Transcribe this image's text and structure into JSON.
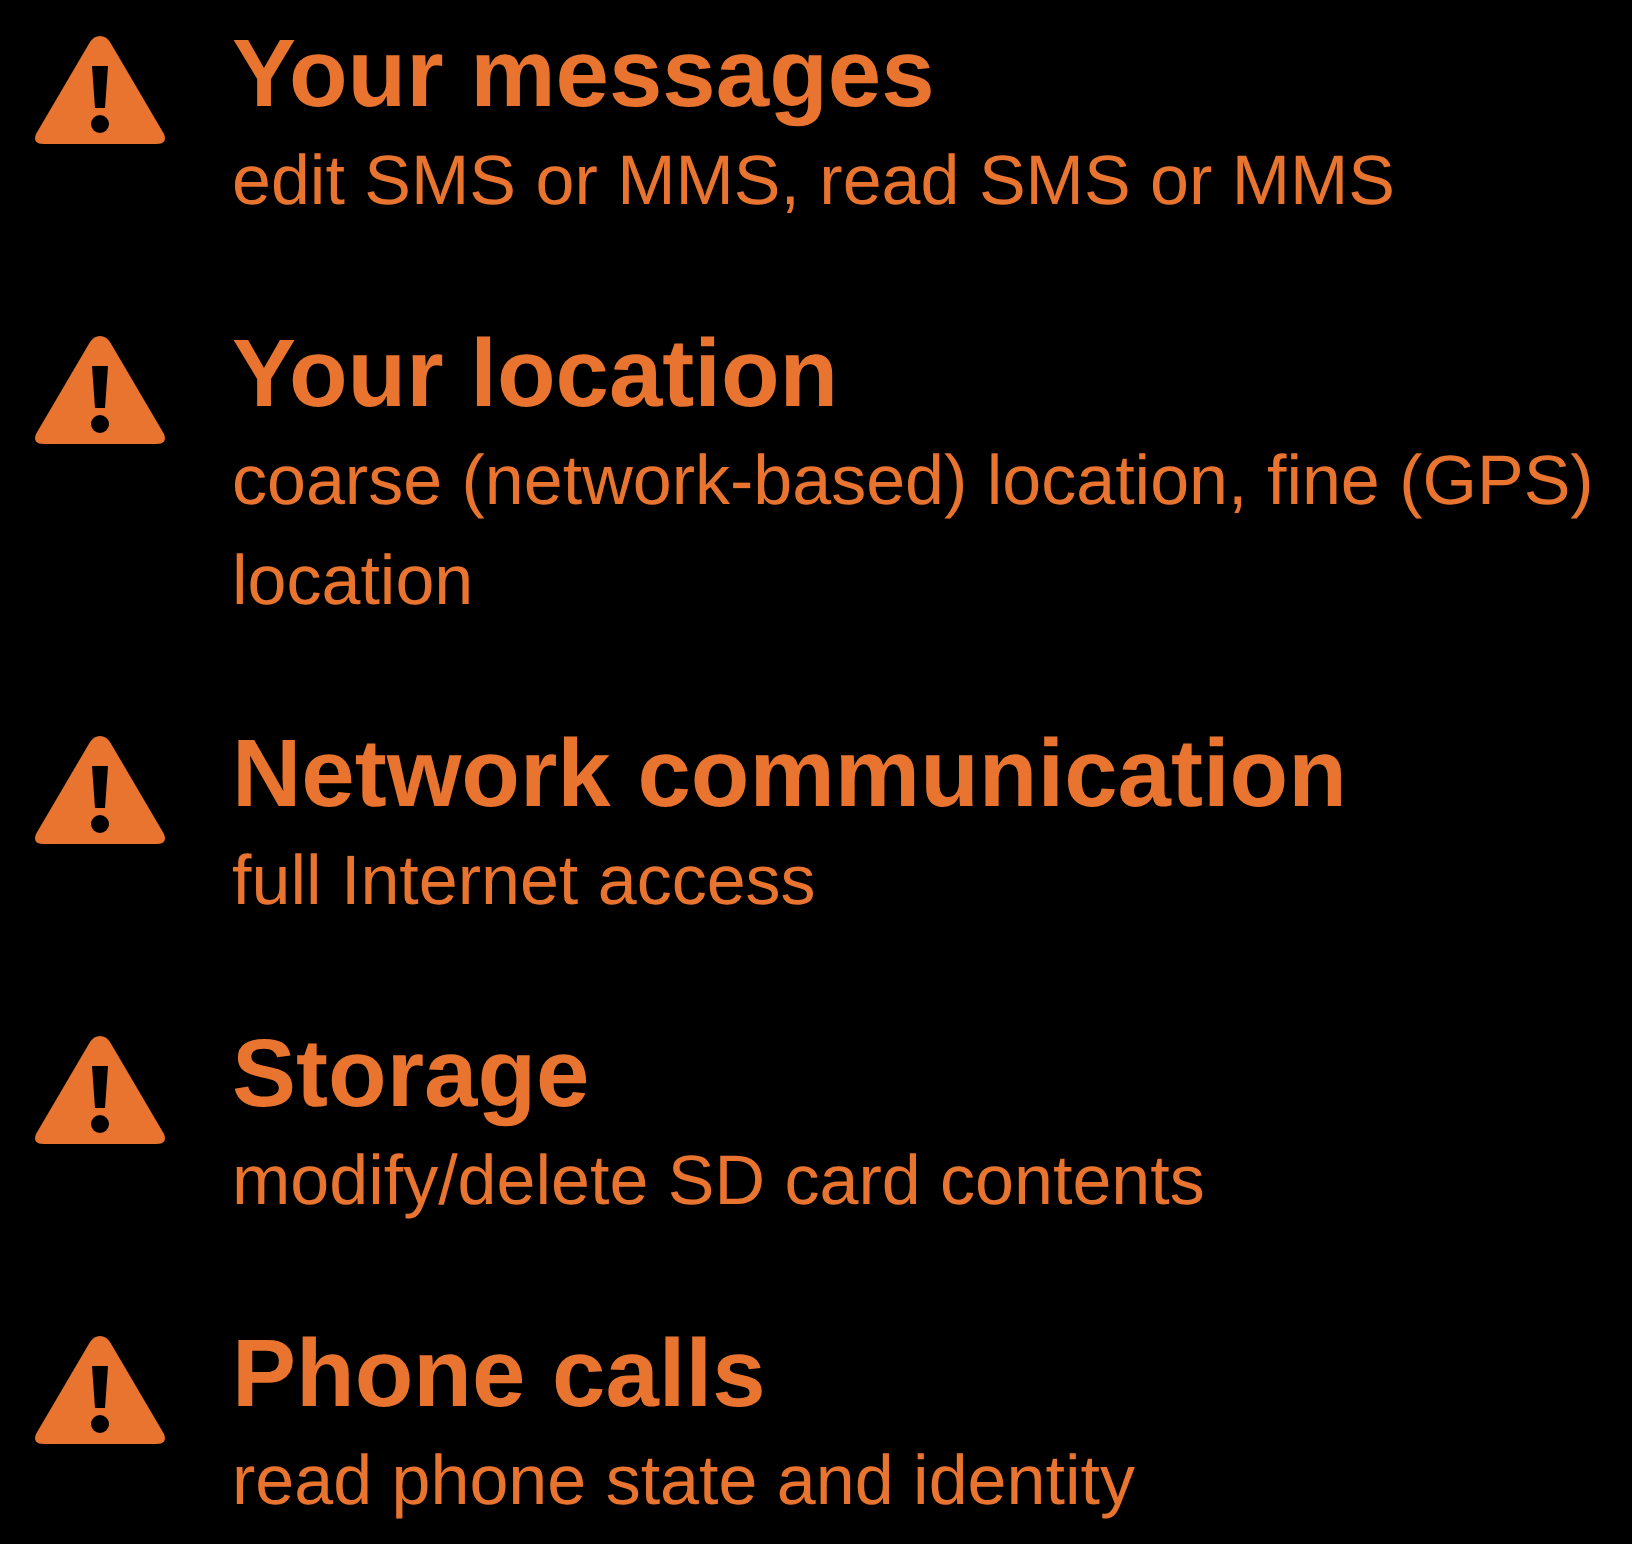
{
  "permissions": [
    {
      "title": "Your messages",
      "description": "edit SMS or MMS, read SMS or MMS"
    },
    {
      "title": "Your location",
      "description": "coarse (network-based) location, fine (GPS) location"
    },
    {
      "title": "Network communication",
      "description": "full Internet access"
    },
    {
      "title": "Storage",
      "description": "modify/delete SD card contents"
    },
    {
      "title": "Phone calls",
      "description": "read phone state and identity"
    }
  ]
}
